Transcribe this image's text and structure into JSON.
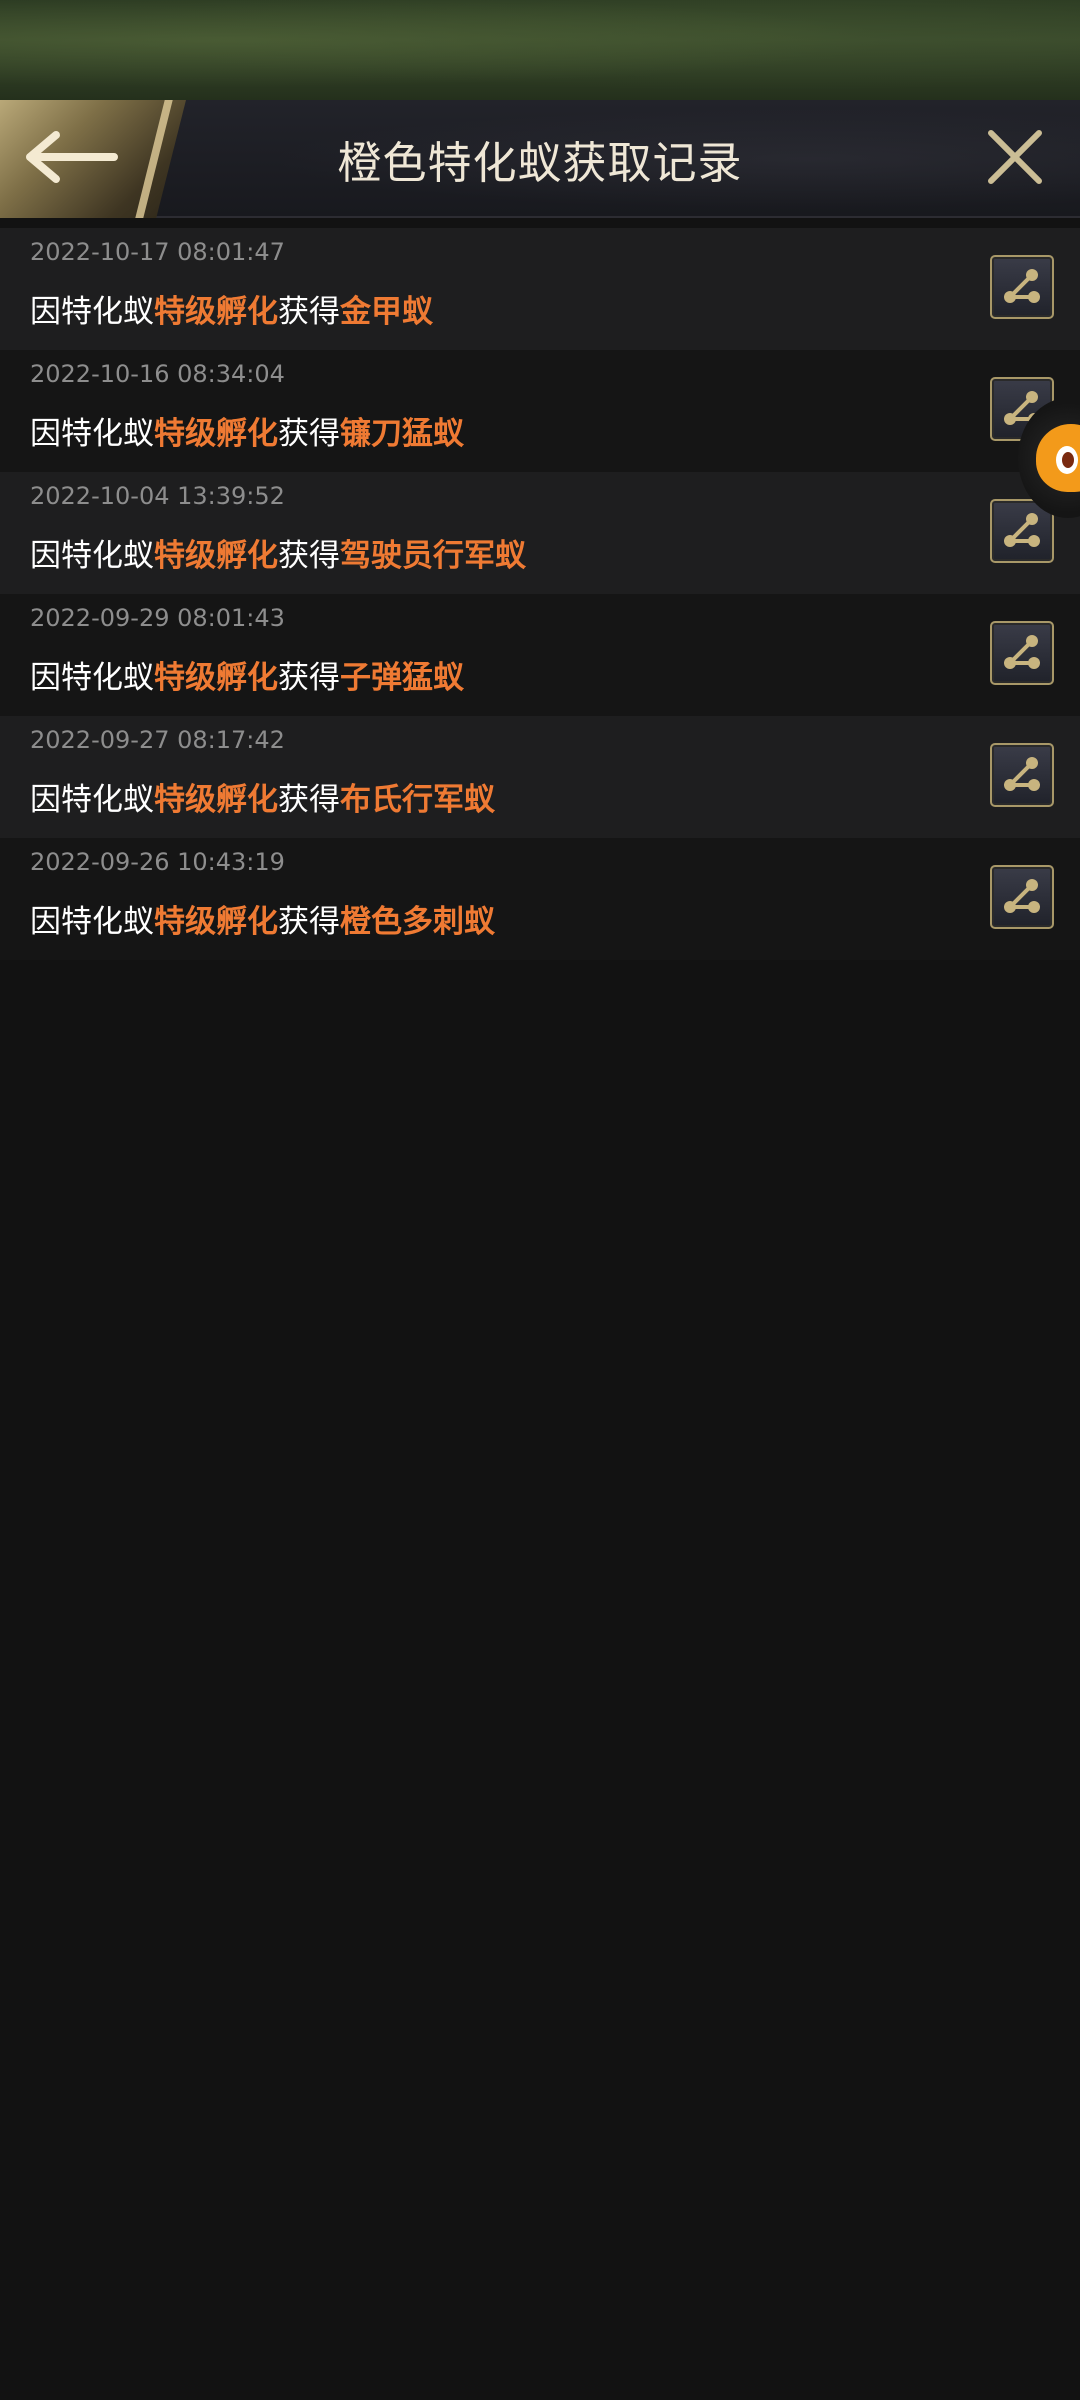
{
  "header": {
    "title": "橙色特化蚁获取记录"
  },
  "icons": {
    "back": "arrow-left-icon",
    "close": "close-icon",
    "share": "share-icon",
    "float": "assistant-float-icon"
  },
  "colors": {
    "highlight": "#ef7a33",
    "gold": "#c8b47f",
    "background": "#121212"
  },
  "records": [
    {
      "time": "2022-10-17 08:01:47",
      "prefix": "因特化蚁",
      "action": "特级孵化",
      "mid": "获得",
      "reward": "金甲蚁"
    },
    {
      "time": "2022-10-16 08:34:04",
      "prefix": "因特化蚁",
      "action": "特级孵化",
      "mid": "获得",
      "reward": "镰刀猛蚁"
    },
    {
      "time": "2022-10-04 13:39:52",
      "prefix": "因特化蚁",
      "action": "特级孵化",
      "mid": "获得",
      "reward": "驾驶员行军蚁"
    },
    {
      "time": "2022-09-29 08:01:43",
      "prefix": "因特化蚁",
      "action": "特级孵化",
      "mid": "获得",
      "reward": "子弹猛蚁"
    },
    {
      "time": "2022-09-27 08:17:42",
      "prefix": "因特化蚁",
      "action": "特级孵化",
      "mid": "获得",
      "reward": "布氏行军蚁"
    },
    {
      "time": "2022-09-26 10:43:19",
      "prefix": "因特化蚁",
      "action": "特级孵化",
      "mid": "获得",
      "reward": "橙色多刺蚁"
    }
  ]
}
